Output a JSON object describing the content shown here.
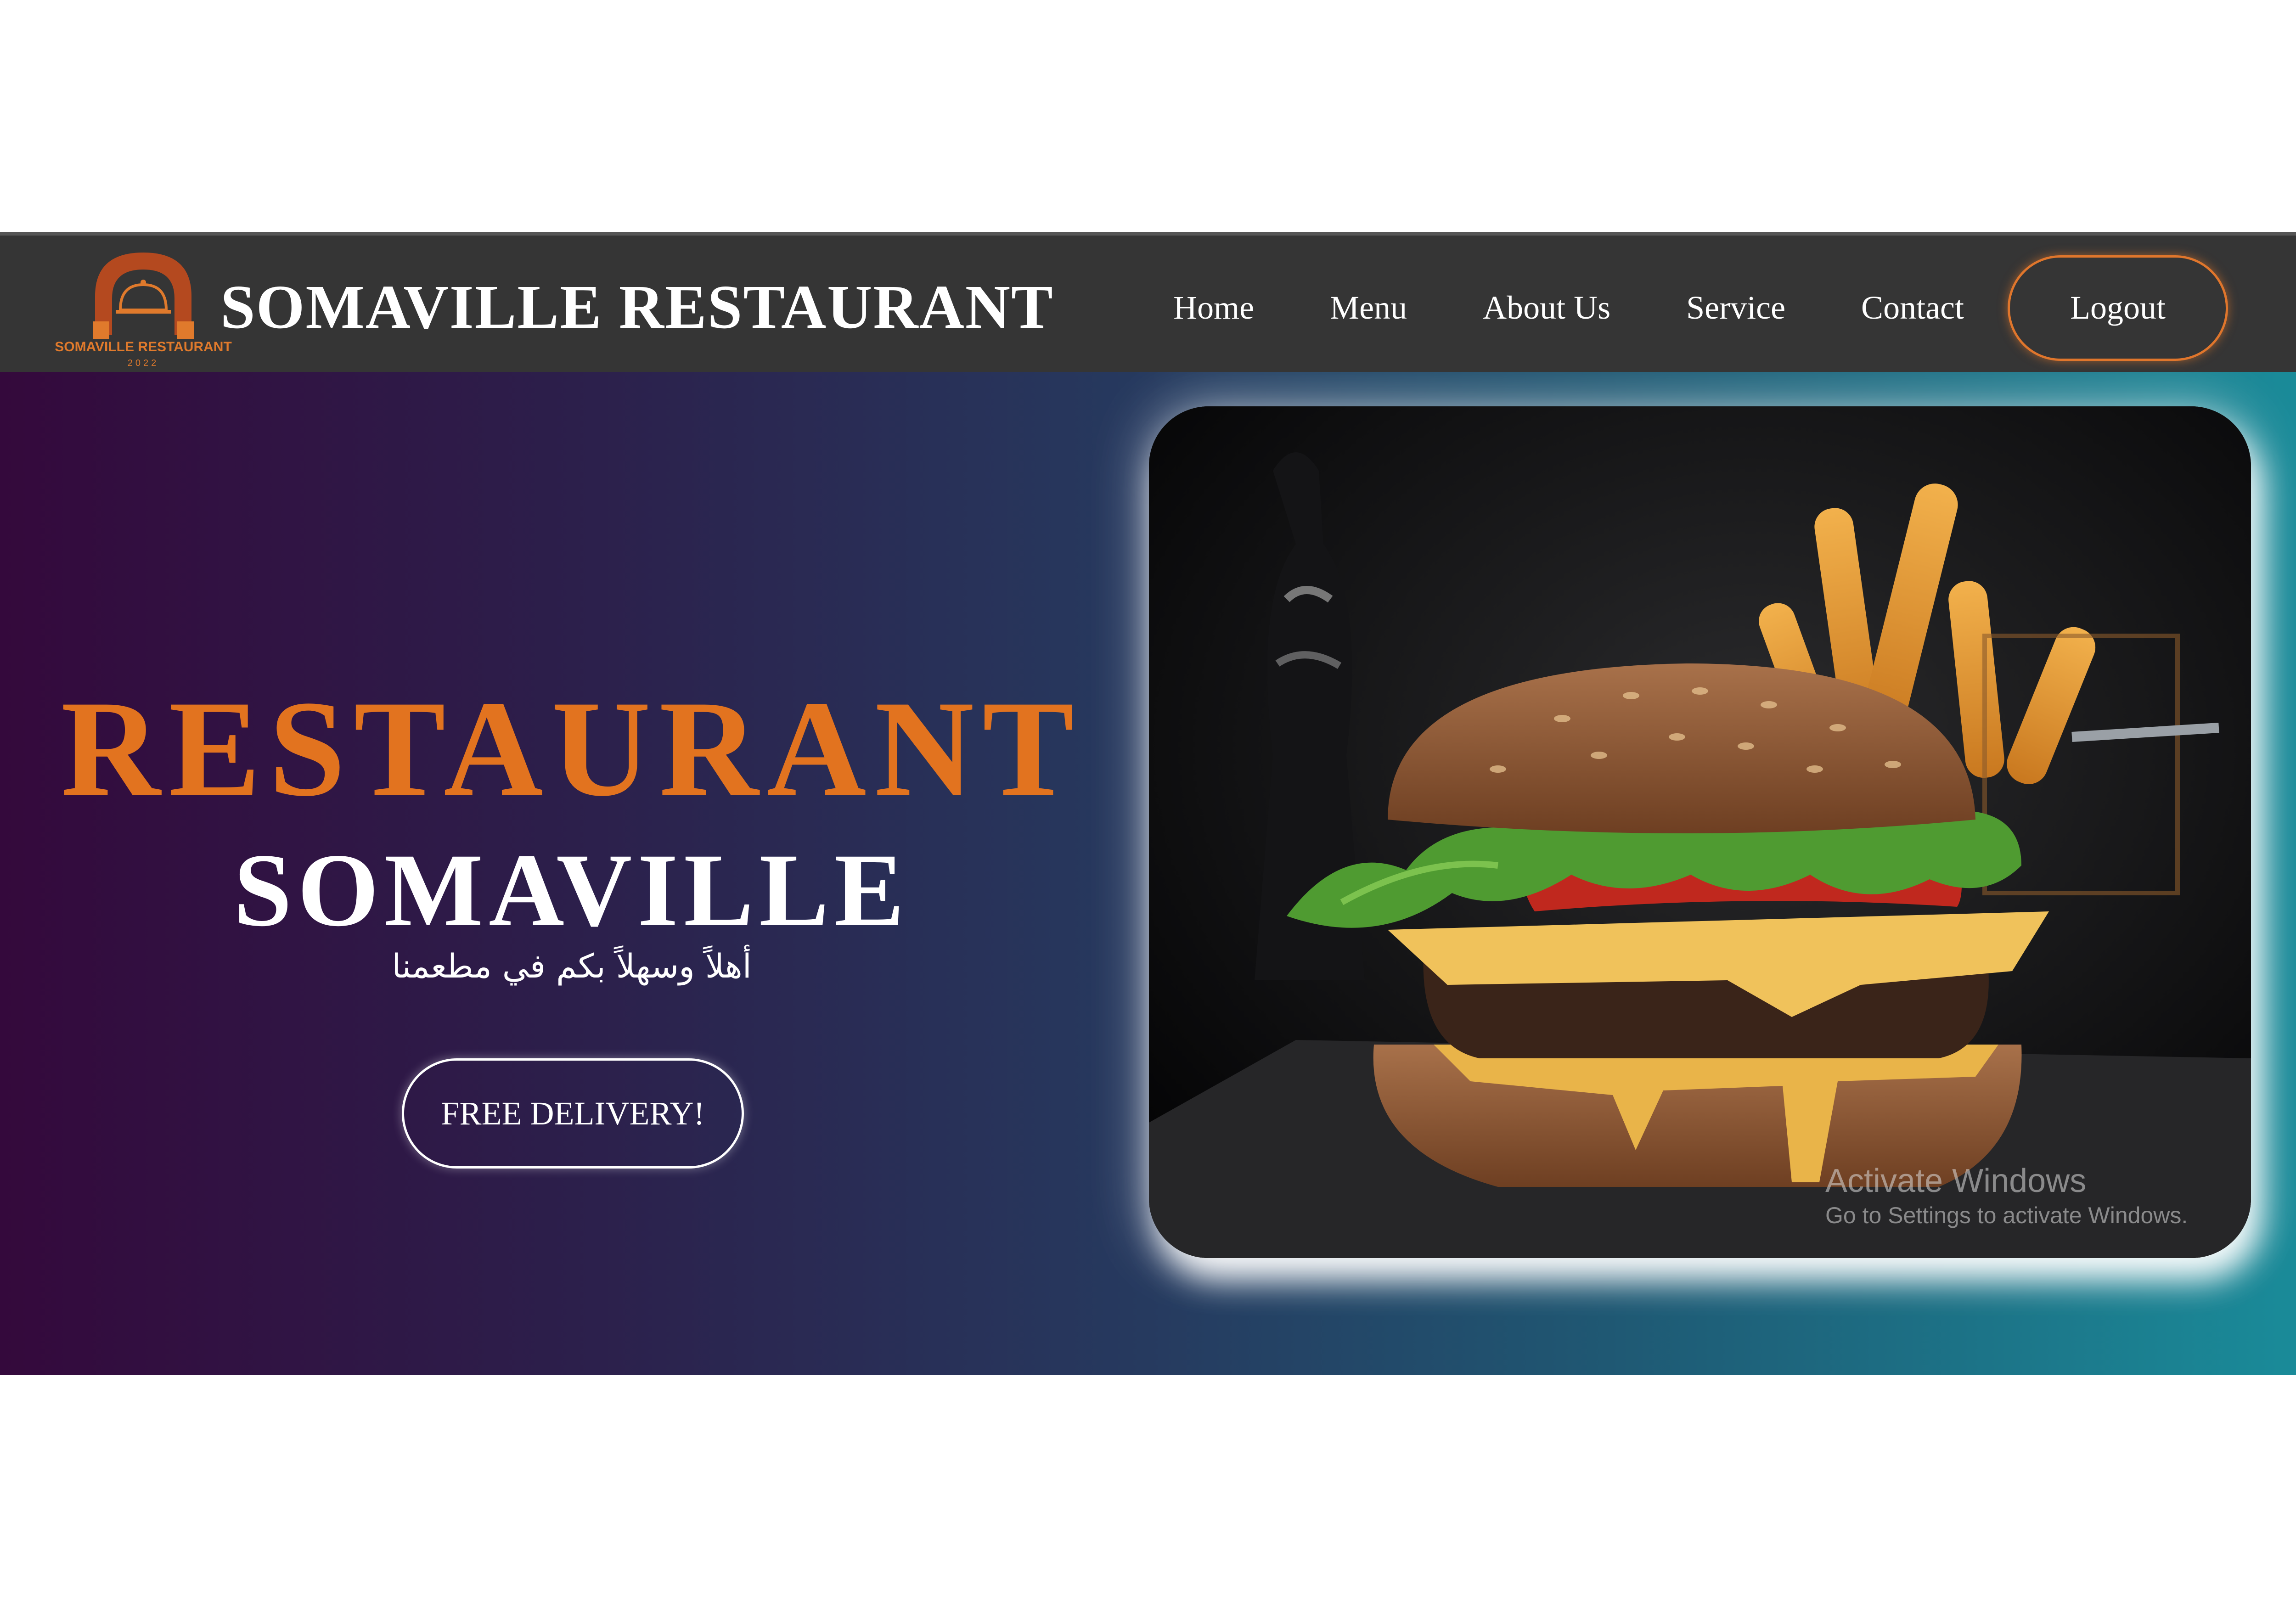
{
  "navbar": {
    "brand": "SOMAVILLE RESTAURANT",
    "logo_text": "SOMAVILLE RESTAURANT",
    "logo_year": "2022",
    "links": [
      {
        "label": "Home"
      },
      {
        "label": "Menu"
      },
      {
        "label": "About Us"
      },
      {
        "label": "Service"
      },
      {
        "label": "Contact"
      }
    ],
    "logout_label": "Logout"
  },
  "hero": {
    "title": "RESTAURANT",
    "subtitle": "SOMAVILLE",
    "arabic_tagline": "أهلاً وسهلاً بكم في مطعمنا",
    "delivery_button": "FREE DELIVERY!",
    "image_icon": "burger-photo"
  },
  "watermark": {
    "line1": "Activate Windows",
    "line2": "Go to Settings to activate Windows."
  },
  "colors": {
    "accent": "#e2731f",
    "navbar_bg": "#353535",
    "hero_gradient_start": "#34093c",
    "hero_gradient_end": "#1a8b99"
  }
}
